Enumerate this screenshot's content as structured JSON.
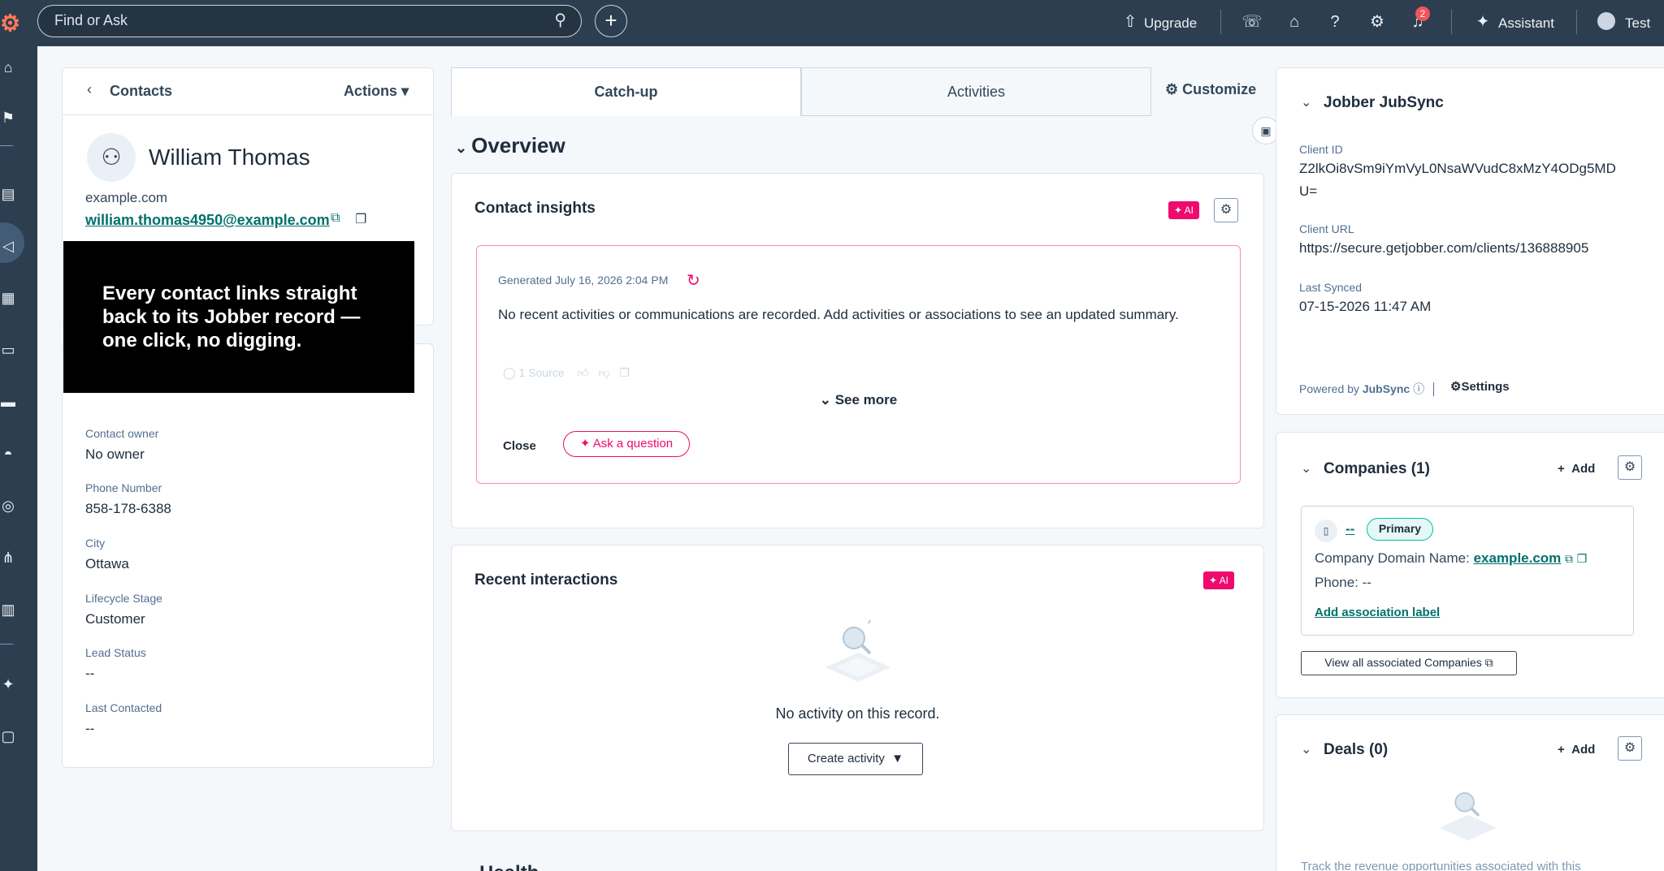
{
  "topbar": {
    "logo": "hubspot-logo",
    "search_placeholder": "Find or Ask",
    "upgrade_label": "Upgrade",
    "assistant_label": "Assistant",
    "user_label": "Test",
    "notifications_count": "2"
  },
  "sidenav": {
    "icons": [
      "home-icon",
      "bookmark-icon",
      "contacts-icon",
      "marketing-icon",
      "content-icon",
      "commerce-icon",
      "payments-icon",
      "service-icon",
      "data-icon",
      "automation-icon",
      "reporting-icon",
      "ai-icon",
      "development-icon"
    ]
  },
  "left_panel": {
    "back_label": "Contacts",
    "actions_label": "Actions",
    "name": "William Thomas",
    "domain": "example.com",
    "email": "william.thomas4950@example.com",
    "properties": [
      {
        "label": "Contact owner",
        "value": "No owner"
      },
      {
        "label": "Phone Number",
        "value": "858-178-6388"
      },
      {
        "label": "City",
        "value": "Ottawa"
      },
      {
        "label": "Lifecycle Stage",
        "value": "Customer"
      },
      {
        "label": "Lead Status",
        "value": "--"
      },
      {
        "label": "Last Contacted",
        "value": "--"
      }
    ]
  },
  "overlay": {
    "text": "Every contact links straight back to its Jobber record — one click, no digging."
  },
  "tabs": [
    {
      "label": "Catch-up",
      "active": true
    },
    {
      "label": "Activities",
      "active": false
    }
  ],
  "customize_label": "Customize",
  "overview": {
    "title": "Overview",
    "insights": {
      "title": "Contact insights",
      "ai_badge": "✦ AI",
      "generated": "Generated July 16, 2026 2:04 PM",
      "summary": "No recent activities or communications are recorded. Add activities or associations to see an updated summary.",
      "source": "1 Source",
      "see_more": "See more",
      "close": "Close",
      "ask": "Ask a question"
    },
    "recent": {
      "title": "Recent interactions",
      "ai_badge": "✦ AI",
      "empty": "No activity on this record.",
      "create": "Create activity"
    },
    "next_section_peek": "Health"
  },
  "right_panel": {
    "jobsync": {
      "title": "Jobber JubSync",
      "client_id_label": "Client ID",
      "client_id": "Z2lkOi8vSm9iYmVyL0NsaWVudC8xMzY4ODg5MDU=",
      "client_id_line1": "Z2lkOi8vSm9iYmVyL0NsaWVudC8xMzY4ODg5MD",
      "client_id_line2": "U=",
      "client_url_label": "Client URL",
      "client_url": "https://secure.getjobber.com/clients/136888905",
      "last_synced_label": "Last Synced",
      "last_synced": "07-15-2026 11:47 AM",
      "powered_prefix": "Powered by ",
      "powered_brand": "JubSync",
      "settings": "Settings"
    },
    "companies": {
      "title": "Companies (1)",
      "add": "Add",
      "company_name": "--",
      "primary": "Primary",
      "domain_label": "Company Domain Name: ",
      "domain": "example.com",
      "phone": "Phone: --",
      "add_assoc": "Add association label",
      "view_all": "View all associated Companies"
    },
    "deals": {
      "title": "Deals (0)",
      "add": "Add",
      "empty": "Track the revenue opportunities associated with this"
    }
  }
}
